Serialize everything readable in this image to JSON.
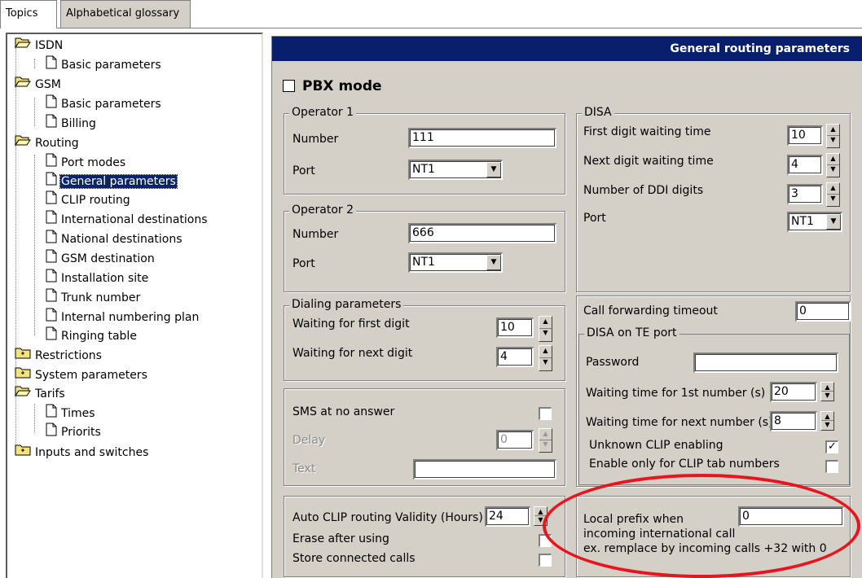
{
  "tabs": [
    "Topics",
    "Alphabetical glossary"
  ],
  "tree": {
    "isdn": "ISDN",
    "isdn_basic": "Basic parameters",
    "gsm": "GSM",
    "gsm_basic": "Basic parameters",
    "gsm_billing": "Billing",
    "routing": "Routing",
    "port_modes": "Port modes",
    "general_parameters": "General parameters",
    "clip_routing": "CLIP routing",
    "international_destinations": "International destinations",
    "national_destinations": "National destinations",
    "gsm_destination": "GSM destination",
    "installation_site": "Installation site",
    "trunk_number": "Trunk number",
    "internal_numbering_plan": "Internal numbering plan",
    "ringing_table": "Ringing table",
    "restrictions": "Restrictions",
    "system_parameters": "System parameters",
    "tarifs": "Tarifs",
    "times": "Times",
    "priorits": "Priorits",
    "inputs_and_switches": "Inputs and switches"
  },
  "panel_title": "General routing parameters",
  "pbx_mode": {
    "label": "PBX mode",
    "checked": false
  },
  "operator1": {
    "legend": "Operator 1",
    "number_label": "Number",
    "number": "111",
    "port_label": "Port",
    "port": "NT1"
  },
  "operator2": {
    "legend": "Operator 2",
    "number_label": "Number",
    "number": "666",
    "port_label": "Port",
    "port": "NT1"
  },
  "dialing": {
    "legend": "Dialing parameters",
    "first_label": "Waiting for first digit",
    "first": "10",
    "next_label": "Waiting for next digit",
    "next": "4"
  },
  "sms": {
    "label": "SMS at no answer",
    "delay_label": "Delay",
    "delay": "0",
    "text_label": "Text",
    "text": ""
  },
  "auto_clip": {
    "validity_label": "Auto CLIP routing Validity (Hours)",
    "validity": "24",
    "erase_label": "Erase after using",
    "store_label": "Store connected calls"
  },
  "disa": {
    "legend": "DISA",
    "first_label": "First digit waiting time",
    "first": "10",
    "next_label": "Next digit waiting time",
    "next": "4",
    "ddi_label": "Number of DDI digits",
    "ddi": "3",
    "port_label": "Port",
    "port": "NT1"
  },
  "call_forward": {
    "label": "Call forwarding timeout",
    "value": "0"
  },
  "disa_te": {
    "legend": "DISA on TE port",
    "password_label": "Password",
    "password": "",
    "wait1_label": "Waiting time for 1st number (s)",
    "wait1": "20",
    "waitn_label": "Waiting time for next number (s)",
    "waitn": "8",
    "unknown_clip_label": "Unknown CLIP enabling",
    "unknown_clip": true,
    "only_clip_label": "Enable only for CLIP tab numbers",
    "only_clip": false
  },
  "local_prefix": {
    "line1": "Local prefix when",
    "value": "0",
    "line2": "incoming international call",
    "line3": "ex. remplace by incoming calls +32 with 0"
  },
  "colors": {
    "title_bar": "#0a1e6e",
    "highlight_oval": "#e8141e",
    "selection": "#0a246a"
  }
}
